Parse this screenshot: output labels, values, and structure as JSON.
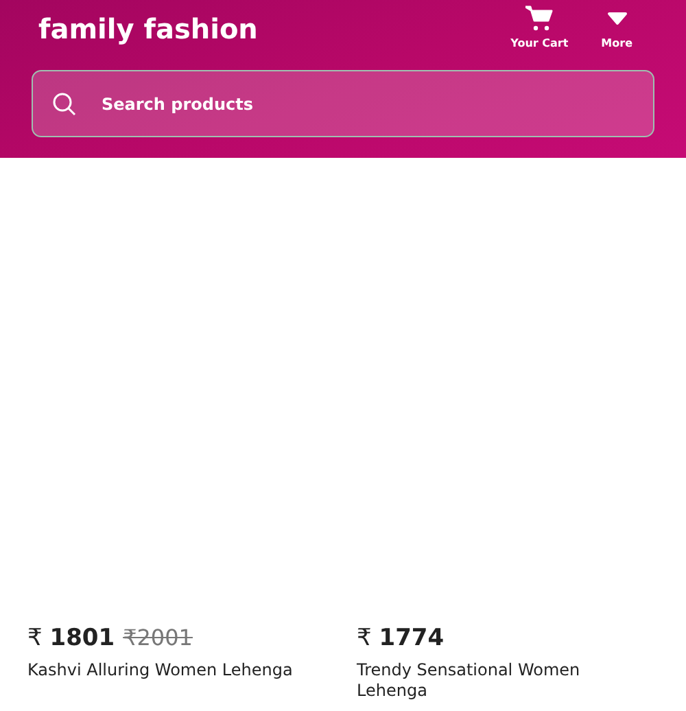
{
  "header": {
    "title": "family fashion",
    "actions": [
      {
        "kind": "cart",
        "label": "Your Cart"
      },
      {
        "kind": "more",
        "label": "More"
      }
    ],
    "search": {
      "placeholder": "Search products"
    }
  },
  "products": [
    {
      "price": "₹ **1801**",
      "mrp": "₹2001",
      "name": "Kashvi Alluring Women Lehenga"
    },
    {
      "price": "₹ **1774**",
      "name": "Trendy Sensational Women Lehenga"
    }
  ]
}
